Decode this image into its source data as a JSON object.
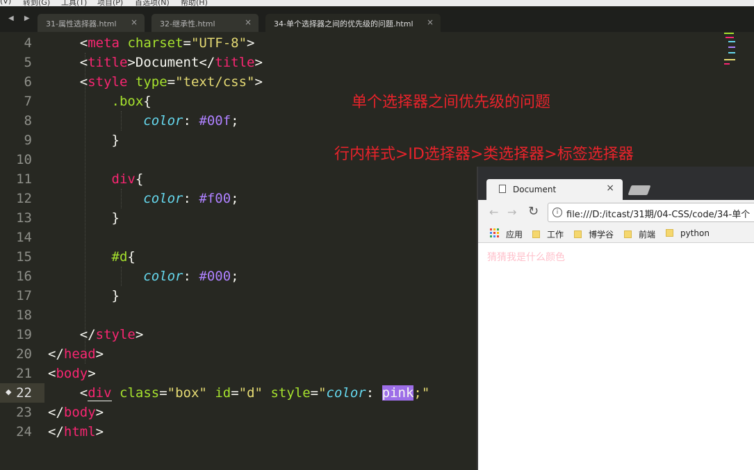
{
  "menubar": [
    "(V)",
    "转到(G)",
    "工具(T)",
    "项目(P)",
    "首选项(N)",
    "帮助(H)"
  ],
  "tabs": [
    {
      "label": "31-属性选择器.html",
      "close": "×"
    },
    {
      "label": "32-继承性.html",
      "close": "×"
    },
    {
      "label": "34-单个选择器之间的优先级的问题.html",
      "close": "×"
    }
  ],
  "line_numbers": [
    "4",
    "5",
    "6",
    "7",
    "8",
    "9",
    "10",
    "11",
    "12",
    "13",
    "14",
    "15",
    "16",
    "17",
    "18",
    "19",
    "20",
    "21",
    "22",
    "23",
    "24"
  ],
  "code": {
    "l4": [
      "<",
      "meta",
      " ",
      "charset",
      "=",
      "\"UTF-8\"",
      ">"
    ],
    "l5": [
      "<",
      "title",
      ">",
      "Document",
      "</",
      "title",
      ">"
    ],
    "l6": [
      "<",
      "style",
      " ",
      "type",
      "=",
      "\"text/css\"",
      ">"
    ],
    "l7": [
      ".box",
      "{"
    ],
    "l8": [
      "color",
      ": ",
      "#00f",
      ";"
    ],
    "l9": [
      "}"
    ],
    "l11": [
      "div",
      "{"
    ],
    "l12": [
      "color",
      ": ",
      "#f00",
      ";"
    ],
    "l13": [
      "}"
    ],
    "l15": [
      "#d",
      "{"
    ],
    "l16": [
      "color",
      ": ",
      "#000",
      ";"
    ],
    "l17": [
      "}"
    ],
    "l19": [
      "</",
      "style",
      ">"
    ],
    "l20": [
      "</",
      "head",
      ">"
    ],
    "l21": [
      "<",
      "body",
      ">"
    ],
    "l22": [
      "<",
      "div",
      " ",
      "class",
      "=",
      "\"box\"",
      " ",
      "id",
      "=",
      "\"d\"",
      " ",
      "style",
      "=",
      "\"",
      "color",
      ": ",
      "pink",
      ";\""
    ],
    "l23": [
      "</",
      "body",
      ">"
    ],
    "l24": [
      "</",
      "html",
      ">"
    ]
  },
  "annotations": {
    "title": "单个选择器之间优先级的问题",
    "rule": "行内样式>ID选择器>类选择器>标签选择器"
  },
  "browser": {
    "tab_title": "Document",
    "tab_close": "×",
    "url": "file:///D:/itcast/31期/04-CSS/code/34-单个",
    "bookmarks": [
      "应用",
      "工作",
      "博学谷",
      "前端",
      "python"
    ],
    "content_text": "猜猜我是什么颜色",
    "content_color": "#ffc0cb"
  },
  "colors": {
    "background": "#272822",
    "tag": "#f92672",
    "attr": "#a6e22e",
    "string": "#e6db74",
    "property": "#66d9ef",
    "number": "#ae81ff",
    "annotation": "#e8232b"
  }
}
